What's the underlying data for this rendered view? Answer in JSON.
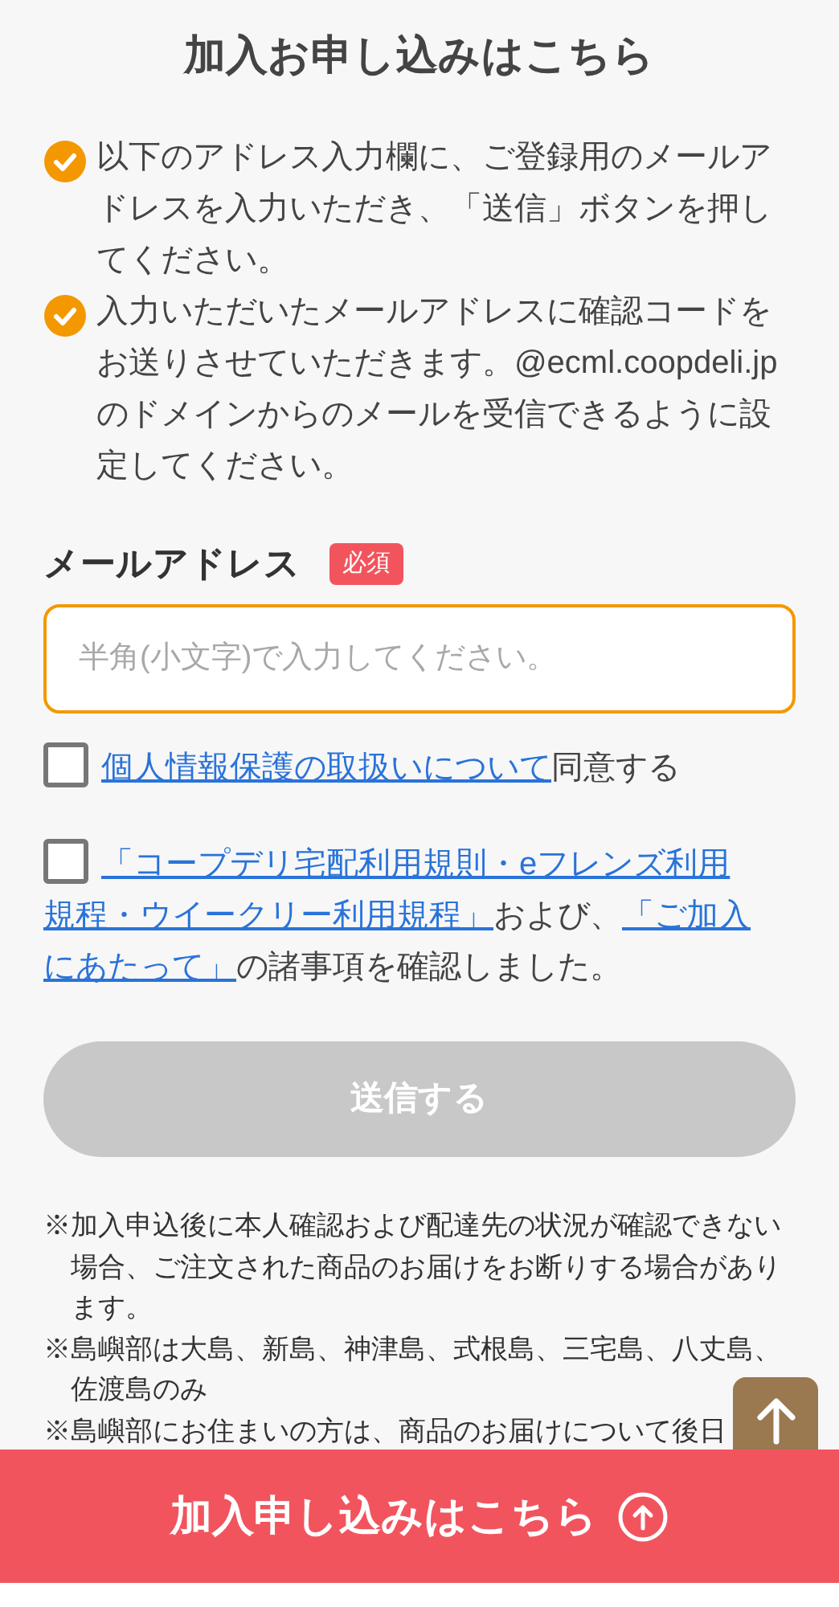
{
  "title": "加入お申し込みはこちら",
  "instructions": [
    "以下のアドレス入力欄に、ご登録用のメールアドレスを入力いただき、「送信」ボタンを押してください。",
    "入力いただいたメールアドレスに確認コードをお送りさせていただきます。@ecml.coopdeli.jpのドメインからのメールを受信できるように設定してください。"
  ],
  "email": {
    "label": "メールアドレス",
    "required_badge": "必須",
    "placeholder": "半角(小文字)で入力してください。"
  },
  "agreements": [
    {
      "checked": false,
      "parts": [
        {
          "text": "個人情報保護の取扱いについて",
          "kind": "link"
        },
        {
          "text": "同意する",
          "kind": "text"
        }
      ]
    },
    {
      "checked": false,
      "parts": [
        {
          "text": "「コープデリ宅配利用規則・eフレンズ利用",
          "kind": "link"
        },
        {
          "text": "規程・ウイークリー利用規程」",
          "kind": "link"
        },
        {
          "text": "および、",
          "kind": "text"
        },
        {
          "text": "「ご加入",
          "kind": "link"
        },
        {
          "text": "にあたって」",
          "kind": "link"
        },
        {
          "text": "の諸事項を確認しました。",
          "kind": "text"
        }
      ]
    }
  ],
  "submit": {
    "label": "送信する",
    "disabled": true
  },
  "notes": [
    "※加入申込後に本人確認および配達先の状況が確認できない場合、ご注文された商品のお届けをお断りする場合があります。",
    "※島嶼部は大島、新島、神津島、式根島、三宅島、八丈島、佐渡島のみ",
    "※島嶼部にお住まいの方は、商品のお届けについて後日"
  ],
  "footer_button": {
    "label": "加入申し込みはこちら"
  }
}
